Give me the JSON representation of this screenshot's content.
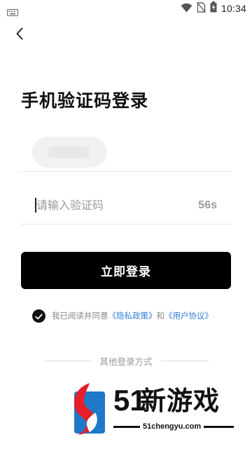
{
  "status_bar": {
    "time": "10:34",
    "icons": [
      "keyboard-icon",
      "wifi-icon",
      "no-sim-icon",
      "battery-charging-icon"
    ]
  },
  "nav": {
    "back_icon": "back-chevron-icon"
  },
  "page": {
    "title": "手机验证码登录"
  },
  "form": {
    "code_placeholder": "请输入验证码",
    "code_value": "",
    "countdown": "56s",
    "login_label": "立即登录"
  },
  "agreement": {
    "checked": true,
    "prefix": "我已阅读并同意",
    "privacy_link": "《隐私政策》",
    "and_text": "和",
    "user_link": "《用户协议》"
  },
  "other_login": {
    "label": "其他登录方式"
  },
  "watermark": {
    "number": "51",
    "chinese": "新游戏",
    "url": "51chengyu.com"
  },
  "colors": {
    "accent": "#000000",
    "link": "#2f7fd6",
    "muted": "#9a9a9a",
    "logo_red": "#e61e2a",
    "logo_blue": "#1f78c8"
  }
}
